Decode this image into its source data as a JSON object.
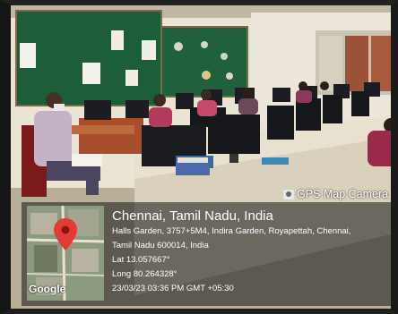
{
  "gps_tag": {
    "label": "GPS Map Camera",
    "icon": "camera-icon"
  },
  "location": {
    "city": "Chennai, Tamil Nadu, India",
    "address_line1": "Halls Garden, 3757+5M4, Indira Garden, Royapettah, Chennai,",
    "address_line2": "Tamil Nadu 600014, India",
    "lat": "Lat 13.057667°",
    "long": "Long 80.264328°",
    "datetime": "23/03/23 03:36 PM GMT +05:30"
  },
  "map": {
    "attribution": "Google",
    "pin_color": "#e53935"
  }
}
